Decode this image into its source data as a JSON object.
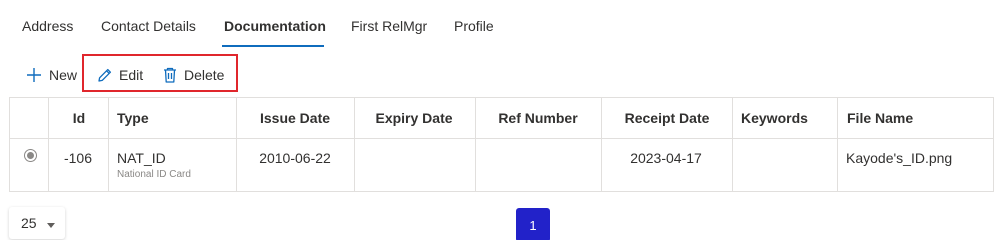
{
  "tabs": [
    {
      "label": "Address"
    },
    {
      "label": "Contact Details"
    },
    {
      "label": "Documentation",
      "active": true
    },
    {
      "label": "First RelMgr"
    },
    {
      "label": "Profile"
    }
  ],
  "toolbar": {
    "new_label": "New",
    "edit_label": "Edit",
    "delete_label": "Delete"
  },
  "table": {
    "columns": [
      "Id",
      "Type",
      "Issue Date",
      "Expiry Date",
      "Ref Number",
      "Receipt Date",
      "Keywords",
      "File Name"
    ],
    "rows": [
      {
        "id": "-106",
        "type": "NAT_ID",
        "type_desc": "National ID Card",
        "issue_date": "2010-06-22",
        "expiry_date": "",
        "ref_number": "",
        "receipt_date": "2023-04-17",
        "keywords": "",
        "file_name": "Kayode's_ID.png"
      }
    ]
  },
  "footer": {
    "page_size": "25",
    "current_page": "1"
  },
  "colors": {
    "accent": "#0f6cbd",
    "highlight": "#e0262c",
    "page_active": "#2222c9"
  }
}
